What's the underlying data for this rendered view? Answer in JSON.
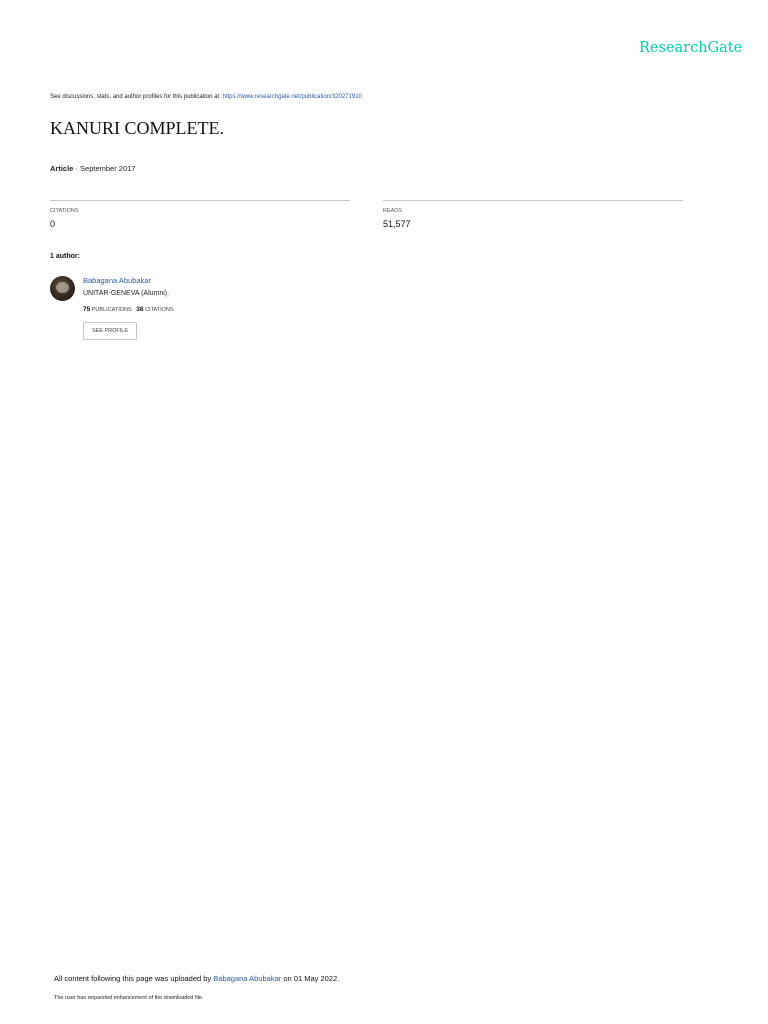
{
  "brand": {
    "logo_text": "ResearchGate"
  },
  "discussion": {
    "prefix": "See discussions, stats, and author profiles for this publication at:",
    "link": "https://www.researchgate.net/publication/320271910"
  },
  "publication": {
    "title": "KANURI COMPLETE.",
    "type": "Article",
    "separator": " · ",
    "date": "September 2017"
  },
  "stats": {
    "citations_label": "CITATIONS",
    "citations_value": "0",
    "reads_label": "READS",
    "reads_value": "51,577"
  },
  "authors": {
    "heading": "1 author:",
    "list": [
      {
        "name": "Babagana Abubakar",
        "affiliation": "UNITAR-GENEVA (Alumni).",
        "publications_count": "75",
        "publications_label": "PUBLICATIONS",
        "citations_count": "38",
        "citations_label": "CITATIONS",
        "profile_button": "SEE PROFILE"
      }
    ]
  },
  "footer": {
    "upload_prefix": "All content following this page was uploaded by",
    "uploader": "Babagana Abubakar",
    "upload_suffix": "on 01 May 2022.",
    "note": "The user has requested enhancement of the downloaded file."
  },
  "colors": {
    "brand": "#00d0af",
    "link": "#2a5aa8",
    "rule": "#c9c9c9"
  }
}
